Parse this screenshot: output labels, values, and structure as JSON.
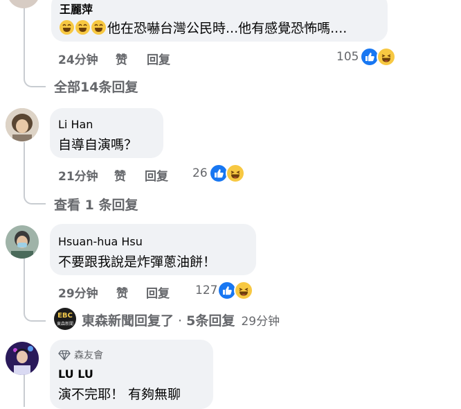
{
  "comments": [
    {
      "name": "王麗萍",
      "text": "他在恐嚇台灣公民時...他有感覺恐怖嗎....",
      "time": "24分钟",
      "like_label": "赞",
      "reply_label": "回复",
      "reactions": "105",
      "thread_label": "全部14条回复"
    },
    {
      "name": "Li Han",
      "text": "自導自演嗎？",
      "time": "21分钟",
      "like_label": "赞",
      "reply_label": "回复",
      "reactions": "26",
      "thread_label": "查看 1 条回复"
    },
    {
      "name": "Hsuan-hua Hsu",
      "text": "不要跟我說是炸彈蔥油餅！",
      "time": "29分钟",
      "like_label": "赞",
      "reply_label": "回复",
      "reactions": "127",
      "reply_summary": {
        "page_name": "東森新聞回复了",
        "separator": " · ",
        "count": "5条回复",
        "time": "29分钟",
        "logo_text": "EBC",
        "logo_sub": "東森新聞"
      }
    },
    {
      "badge": "森友會",
      "name": "LU LU",
      "text": "演不完耶！ 有夠無聊"
    }
  ],
  "colors": {
    "bubble": "#f0f2f5",
    "meta": "#65676b",
    "like": "#1877f2",
    "haha": "#f7c842",
    "thread_line": "#c8ccd1"
  },
  "icons": [
    "like-icon",
    "haha-icon",
    "grinning-emoji-icon",
    "diamond-badge-icon"
  ]
}
